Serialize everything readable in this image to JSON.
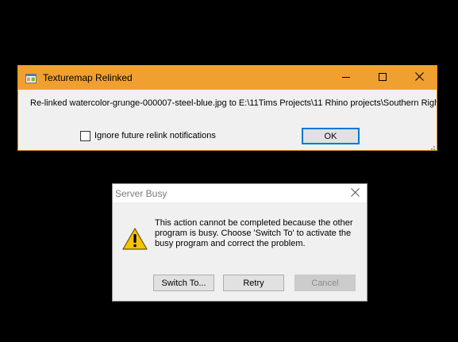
{
  "relink_dialog": {
    "title": "Texturemap Relinked",
    "message": "Re-linked watercolor-grunge-000007-steel-blue.jpg to E:\\11Tims Projects\\11 Rhino projects\\Southern Right Whale",
    "checkbox_label": "Ignore future relink notifications",
    "checkbox_checked": false,
    "ok_label": "OK",
    "titlebar_color": "#f0a030",
    "icons": {
      "app": "app-window-icon",
      "minimize": "minimize-icon",
      "maximize": "maximize-icon",
      "close": "close-icon",
      "resize": "resize-grip-icon"
    }
  },
  "busy_dialog": {
    "title": "Server Busy",
    "message": "This action cannot be completed because the other program is busy. Choose 'Switch To' to activate the busy program and correct the problem.",
    "buttons": {
      "switch_to": "Switch To...",
      "retry": "Retry",
      "cancel": "Cancel"
    },
    "cancel_enabled": false,
    "icons": {
      "warning": "warning-icon",
      "close": "close-icon"
    }
  }
}
